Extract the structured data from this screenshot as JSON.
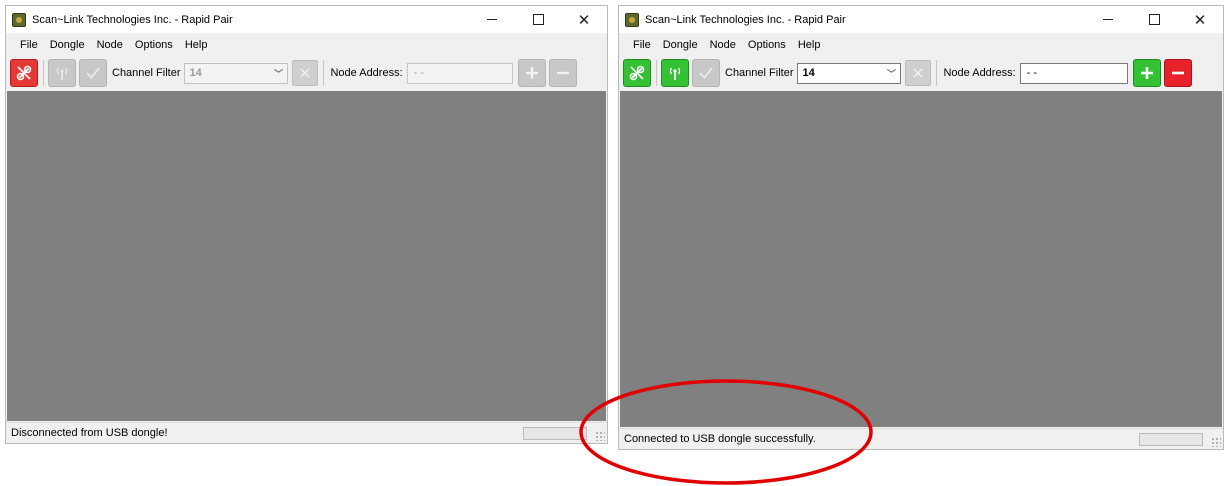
{
  "windows": [
    {
      "title": "Scan~Link Technologies Inc. - Rapid Pair",
      "menu": [
        "File",
        "Dongle",
        "Node",
        "Options",
        "Help"
      ],
      "toolbar": {
        "channel_filter_label": "Channel Filter",
        "channel_value": "14",
        "node_address_label": "Node Address:",
        "node_address_value": "- -",
        "connected": false
      },
      "status": "Disconnected from USB dongle!"
    },
    {
      "title": "Scan~Link Technologies Inc. - Rapid Pair",
      "menu": [
        "File",
        "Dongle",
        "Node",
        "Options",
        "Help"
      ],
      "toolbar": {
        "channel_filter_label": "Channel Filter",
        "channel_value": "14",
        "node_address_label": "Node Address:",
        "node_address_value": "- -",
        "connected": true
      },
      "status": "Connected to USB dongle successfully."
    }
  ],
  "colors": {
    "connect_disconnected": "#e53935",
    "connect_connected": "#34c234",
    "disabled_gray": "#c8c8c8",
    "add_button": "#34c234",
    "remove_button": "#e8222b",
    "content_background": "#808080",
    "highlight_ellipse": "#e00000"
  },
  "icons": {
    "connect": "unlink-icon",
    "antenna": "antenna-icon",
    "confirm": "checkmark-icon",
    "clear": "close-icon",
    "add": "plus-icon",
    "remove": "minus-icon"
  }
}
